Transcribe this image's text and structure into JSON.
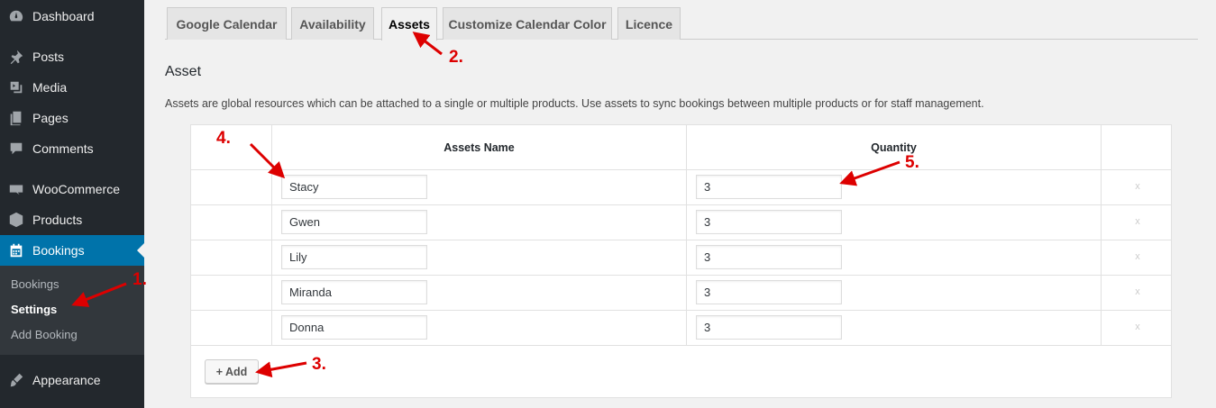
{
  "sidebar": {
    "items": [
      {
        "label": "Dashboard",
        "icon": "dashboard-icon"
      },
      {
        "label": "Posts",
        "icon": "pin-icon"
      },
      {
        "label": "Media",
        "icon": "media-icon"
      },
      {
        "label": "Pages",
        "icon": "pages-icon"
      },
      {
        "label": "Comments",
        "icon": "comment-icon"
      },
      {
        "label": "WooCommerce",
        "icon": "woocommerce-icon"
      },
      {
        "label": "Products",
        "icon": "box-icon"
      },
      {
        "label": "Bookings",
        "icon": "calendar-icon"
      },
      {
        "label": "Appearance",
        "icon": "brush-icon"
      }
    ],
    "submenu": [
      "Bookings",
      "Settings",
      "Add Booking"
    ],
    "current_sub": "Settings"
  },
  "tabs": [
    "Google Calendar",
    "Availability",
    "Assets",
    "Customize Calendar Color",
    "Licence"
  ],
  "active_tab": "Assets",
  "section": {
    "heading": "Asset",
    "description": "Assets are global resources which can be attached to a single or multiple products. Use assets to sync bookings between multiple products or for staff management."
  },
  "table": {
    "columns": [
      "Assets Name",
      "Quantity"
    ],
    "rows": [
      {
        "name": "Stacy",
        "quantity": "3"
      },
      {
        "name": "Gwen",
        "quantity": "3"
      },
      {
        "name": "Lily",
        "quantity": "3"
      },
      {
        "name": "Miranda",
        "quantity": "3"
      },
      {
        "name": "Donna",
        "quantity": "3"
      }
    ],
    "remove_glyph": "x",
    "add_label": "+ Add"
  },
  "annotations": [
    "1.",
    "2.",
    "3.",
    "4.",
    "5."
  ],
  "colors": {
    "sidebar_bg": "#23282d",
    "active_blue": "#0073aa",
    "annotation_red": "#dd0000"
  }
}
